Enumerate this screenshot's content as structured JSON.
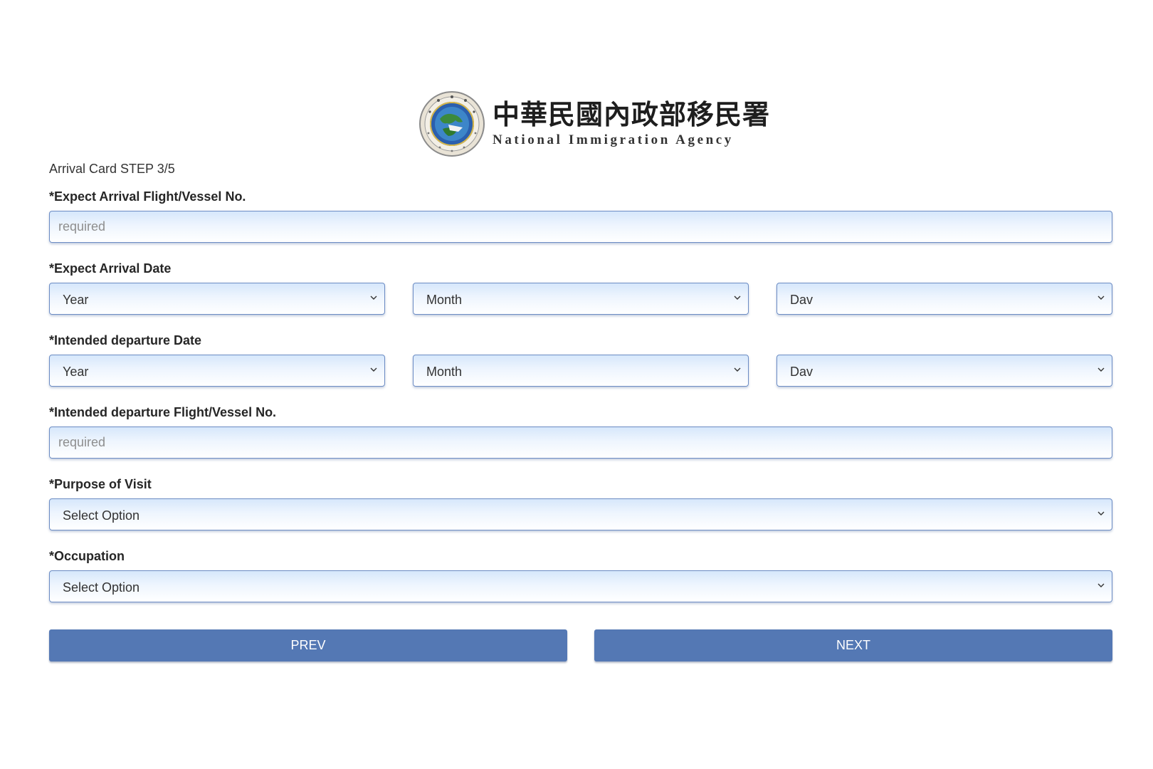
{
  "header": {
    "title_cn": "中華民國內政部移民署",
    "title_en": "National Immigration Agency",
    "seal_icon": "nia-seal-icon"
  },
  "step_text": "Arrival Card STEP 3/5",
  "fields": {
    "arrival_flight": {
      "label": "*Expect Arrival Flight/Vessel No.",
      "placeholder": "required",
      "value": ""
    },
    "arrival_date": {
      "label": "*Expect Arrival Date",
      "year": "Year",
      "month": "Month",
      "day": "Dav"
    },
    "departure_date": {
      "label": "*Intended departure Date",
      "year": "Year",
      "month": "Month",
      "day": "Dav"
    },
    "departure_flight": {
      "label": "*Intended departure Flight/Vessel No.",
      "placeholder": "required",
      "value": ""
    },
    "purpose": {
      "label": "*Purpose of Visit",
      "selected": "Select Option"
    },
    "occupation": {
      "label": "*Occupation",
      "selected": "Select Option"
    }
  },
  "buttons": {
    "prev": "PREV",
    "next": "NEXT"
  },
  "colors": {
    "button_bg": "#5478b4",
    "field_border": "#6c8cc4",
    "field_gradient_top": "#d6e7fb"
  }
}
